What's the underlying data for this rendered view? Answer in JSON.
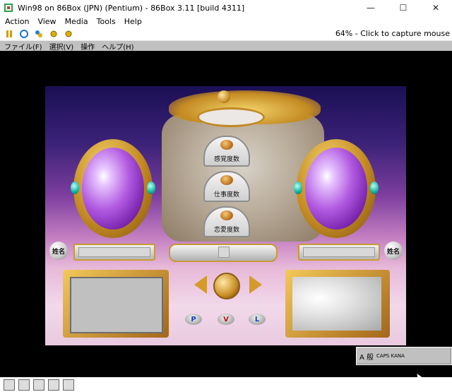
{
  "window": {
    "title": "Win98 on 86Box (JPN) (Pentium) - 86Box 3.11 [build 4311]",
    "minimize": "—",
    "maximize": "☐",
    "close": "✕"
  },
  "menu": {
    "action": "Action",
    "view": "View",
    "media": "Media",
    "tools": "Tools",
    "help": "Help"
  },
  "toolbar": {
    "capture_text": "64% - Click to capture mouse"
  },
  "guest_menu": {
    "file": "ファイル(F)",
    "select": "選択(V)",
    "operate": "操作",
    "help": "ヘルプ(H)"
  },
  "game": {
    "domes": [
      "感覚度数",
      "仕事度数",
      "恋愛度数"
    ],
    "name_label": "姓名",
    "buttons": [
      "P",
      "V",
      "L"
    ]
  },
  "ime": {
    "mode": "A 般",
    "caps": "CAPS KANA"
  },
  "colors": {
    "gold": "#c48b22",
    "sky_top": "#1a0f55",
    "sky_bottom": "#f2d9ea",
    "dome_text": "#111111",
    "button_v": "#c0101a",
    "button_pl": "#1a3fb0"
  }
}
